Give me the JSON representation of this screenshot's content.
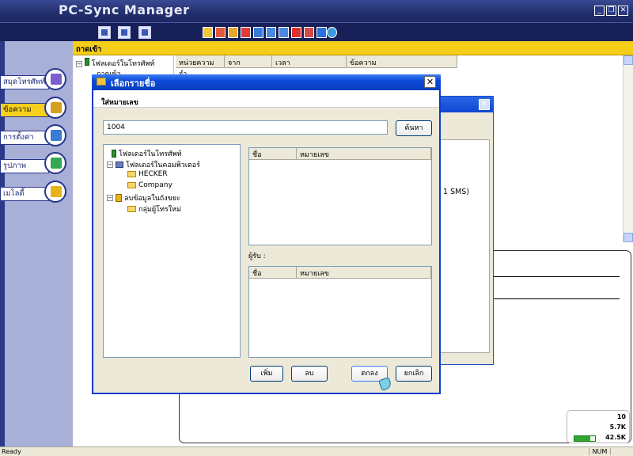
{
  "app": {
    "title": "PC-Sync Manager"
  },
  "window_controls": [
    "_",
    "❐",
    "✕"
  ],
  "left_nav": [
    {
      "label": "สมุดโทรศัพท์",
      "icon": "phone-book-icon",
      "color": "#7b5fd0"
    },
    {
      "label": "ข้อความ",
      "icon": "message-icon",
      "color": "#d4a020",
      "active": true
    },
    {
      "label": "การตั้งค่า",
      "icon": "settings-icon",
      "color": "#3a7bd5"
    },
    {
      "label": "รูปภาพ",
      "icon": "picture-icon",
      "color": "#34a853"
    },
    {
      "label": "เมโลดี้",
      "icon": "melody-icon",
      "color": "#e8b318"
    }
  ],
  "main": {
    "header_title": "ถาดเข้า",
    "tree": [
      {
        "label": "โฟลเดอร์ในโทรศัพท์"
      },
      {
        "label": "ถาดเข้า"
      }
    ],
    "columns": [
      "หน่วยความจำ",
      "จาก",
      "เวลา",
      "ข้อความ"
    ],
    "sms_count_text": "1 SMS)"
  },
  "dialog": {
    "title": "เลือกรายชื่อ",
    "close_label": "✕",
    "header_label": "ใส่หมายเลข",
    "number_value": "1004",
    "search_button": "ค้นหา",
    "tree": [
      {
        "label": "โฟลเดอร์ในโทรศัพท์",
        "type": "phone"
      },
      {
        "label": "โฟลเดอร์ในคอมพิวเตอร์",
        "type": "pc"
      },
      {
        "label": "HECKER",
        "type": "folder"
      },
      {
        "label": "Company",
        "type": "folder"
      },
      {
        "label": "ลบข้อมูลในถังขยะ",
        "type": "bin"
      },
      {
        "label": "กลุ่มผู้โทรใหม่",
        "type": "folder"
      }
    ],
    "contacts_columns": [
      "ชื่อ",
      "หมายเลข"
    ],
    "recipient_label": "ผู้รับ :",
    "recipients_columns": [
      "ชื่อ",
      "หมายเลข"
    ],
    "buttons": {
      "add": "เพิ่ม",
      "delete": "ลบ",
      "ok": "ตกลง",
      "cancel": "ยกเลิก"
    }
  },
  "stats": {
    "count": "10",
    "size1": "5.7K",
    "size2": "42.5K",
    "fill_fraction": 0.75
  },
  "status": {
    "ready": "Ready",
    "num": "NUM"
  }
}
